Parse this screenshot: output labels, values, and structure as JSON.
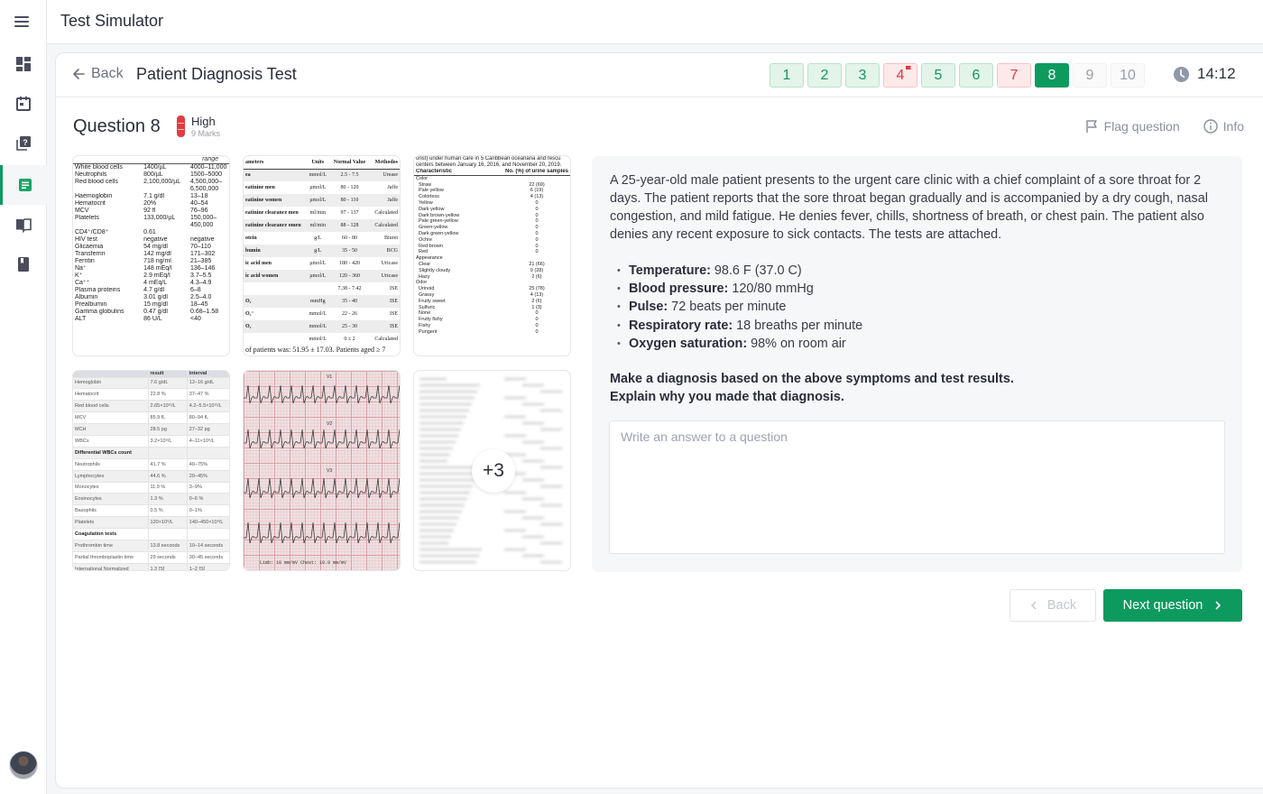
{
  "app": {
    "title": "Test Simulator"
  },
  "sidebar": {
    "items": [
      {
        "name": "dashboard",
        "icon": "dashboard-icon",
        "active": false
      },
      {
        "name": "calendar",
        "icon": "calendar-icon",
        "active": false
      },
      {
        "name": "question-bank",
        "icon": "question-bank-icon",
        "active": false
      },
      {
        "name": "tests",
        "icon": "document-icon",
        "active": true
      },
      {
        "name": "library",
        "icon": "open-book-icon",
        "active": false
      },
      {
        "name": "bookmarks",
        "icon": "book-icon",
        "active": false
      }
    ],
    "accent_color": "#0d9a5f"
  },
  "header": {
    "back_label": "Back",
    "test_title": "Patient Diagnosis Test",
    "timer": "14:12",
    "questions": [
      {
        "label": "1",
        "status": "done"
      },
      {
        "label": "2",
        "status": "done"
      },
      {
        "label": "3",
        "status": "done"
      },
      {
        "label": "4",
        "status": "wrong",
        "flagged": true
      },
      {
        "label": "5",
        "status": "done"
      },
      {
        "label": "6",
        "status": "done"
      },
      {
        "label": "7",
        "status": "wrong"
      },
      {
        "label": "8",
        "status": "current"
      },
      {
        "label": "9",
        "status": "todo"
      },
      {
        "label": "10",
        "status": "todo"
      }
    ]
  },
  "question": {
    "title": "Question 8",
    "difficulty": "High",
    "marks": "9 Marks",
    "flag_label": "Flag question",
    "info_label": "Info",
    "case_text": "A 25-year-old male patient presents to the urgent care clinic with a chief complaint of a sore throat for 2 days. The patient reports that the sore throat began gradually and is accompanied by a dry cough, nasal congestion, and mild fatigue. He denies fever, chills, shortness of breath, or chest pain. The patient also denies any recent exposure to sick contacts. The tests are attached.",
    "vitals": [
      {
        "label": "Temperature:",
        "value": " 98.6 F (37.0 C)"
      },
      {
        "label": "Blood pressure:",
        "value": " 120/80 mmHg"
      },
      {
        "label": "Pulse:",
        "value": " 72 beats per minute"
      },
      {
        "label": "Respiratory rate:",
        "value": " 18 breaths per minute"
      },
      {
        "label": "Oxygen saturation:",
        "value": " 98% on room air"
      }
    ],
    "prompt_line1": "Make a diagnosis based on the above symptoms and test results.",
    "prompt_line2": "Explain why you made that diagnosis.",
    "answer_placeholder": "Write an answer to a question",
    "answer_value": ""
  },
  "attachments": {
    "more_count": "+3",
    "lab1": {
      "header": "range",
      "rows": [
        [
          "White blood cells",
          "1400/µL",
          "4000–11,000"
        ],
        [
          "Neutrophils",
          "800/µL",
          "1500–5000"
        ],
        [
          "Red blood cells",
          "2,100,000/µL",
          "4,500,000–"
        ],
        [
          "",
          "",
          "6,500,000"
        ],
        [
          "Haemoglobin",
          "7.1 g/dl",
          "13–18"
        ],
        [
          "Hematocrit",
          "20%",
          "40–54"
        ],
        [
          "MCV",
          "92 fl",
          "76–96"
        ],
        [
          "Platelets",
          "133,000/µL",
          "150,000–"
        ],
        [
          "",
          "",
          "450,000"
        ],
        [
          "CD4⁺/CD8⁺",
          "0.61",
          ""
        ],
        [
          "HIV test",
          "negative",
          "negative"
        ],
        [
          "Glicaemia",
          "54 mg/dl",
          "70–110"
        ],
        [
          "Transferrin",
          "142 mg/dl",
          "171–302"
        ],
        [
          "Ferritin",
          "718 ng/ml",
          "21–385"
        ],
        [
          "Na⁺",
          "148 mEq/l",
          "136–146"
        ],
        [
          "K⁺",
          "2.9 mEq/l",
          "3.7–5.5"
        ],
        [
          "Ca⁺⁺",
          "4 mEq/L",
          "4.3–4.9"
        ],
        [
          "Plasma proteins",
          "4.7 g/dl",
          "6–8"
        ],
        [
          "Albumin",
          "3.01 g/dl",
          "2.5–4.0"
        ],
        [
          "Prealbumin",
          "15 mg/dl",
          "18–45"
        ],
        [
          "Gamma globulins",
          "0.47 g/dl",
          "0.68–1.58"
        ],
        [
          "ALT",
          "86 U/L",
          "<40"
        ]
      ]
    },
    "lab2": {
      "header": [
        "ameters",
        "Units",
        "Normal Value",
        "Methodos"
      ],
      "rows": [
        [
          "ea",
          "mmol/L",
          "2.5 - 7.5",
          "Urease"
        ],
        [
          "eatinine men",
          "µmol/L",
          "80 - 120",
          "Jaffe"
        ],
        [
          "eatinine women",
          "µmol/L",
          "80 - 110",
          "Jaffe"
        ],
        [
          "eatinine clearance men",
          "ml/min",
          "97 - 137",
          "Calculated"
        ],
        [
          "eatinine clearance omen",
          "ml/min",
          "88 - 128",
          "Calculated"
        ],
        [
          "otein",
          "g/L",
          "60 - 80",
          "Biuret"
        ],
        [
          "bumin",
          "g/L",
          "35 - 50",
          "BCG"
        ],
        [
          "ic acid men",
          "µmol/L",
          "180 - 420",
          "Uricase"
        ],
        [
          "ic acid women",
          "µmol/L",
          "120 - 360",
          "Uricase"
        ],
        [
          "",
          "",
          "7.38 - 7.42",
          "ISE"
        ],
        [
          "O₂",
          "mmHg",
          "35 - 40",
          "ISE"
        ],
        [
          "O₃⁻",
          "mmol/L",
          "22 - 26",
          "ISE"
        ],
        [
          "O₂",
          "mmol/L",
          "25 - 30",
          "ISE"
        ],
        [
          "",
          "mmol/L",
          "0 ± 2",
          "Calculated"
        ]
      ],
      "footer": "of patients was: 51.95 ± 17.03. Patients aged ≥ 7"
    },
    "lab3": {
      "caption": [
        "urist) under human care in 5 Caribbean oceanaria and rescu",
        "centers between January 16, 2016, and November 20, 2019."
      ],
      "header": [
        "Characteristic",
        "No. (%) of urine samples"
      ],
      "rows": [
        [
          "Color",
          "",
          "group"
        ],
        [
          "Straw",
          "22 (69)",
          ""
        ],
        [
          "Pale yellow",
          "6 (19)",
          ""
        ],
        [
          "Colorless",
          "4 (13)",
          ""
        ],
        [
          "Yellow",
          "0",
          ""
        ],
        [
          "Dark yellow",
          "0",
          ""
        ],
        [
          "Dark brown-yellow",
          "0",
          ""
        ],
        [
          "Pale green-yellow",
          "0",
          ""
        ],
        [
          "Green-yellow",
          "0",
          ""
        ],
        [
          "Dark green-yellow",
          "0",
          ""
        ],
        [
          "Ochre",
          "0",
          ""
        ],
        [
          "Red-brown",
          "0",
          ""
        ],
        [
          "Red",
          "0",
          ""
        ],
        [
          "",
          "",
          "gap"
        ],
        [
          "Appearance",
          "",
          "group"
        ],
        [
          "Clear",
          "21 (66)",
          ""
        ],
        [
          "Slightly cloudy",
          "9 (28)",
          ""
        ],
        [
          "Hazy",
          "2 (6)",
          ""
        ],
        [
          "",
          "",
          "gap"
        ],
        [
          "Odor",
          "",
          "group"
        ],
        [
          "Urinoid",
          "25 (78)",
          ""
        ],
        [
          "Grassy",
          "4 (13)",
          ""
        ],
        [
          "Fruity sweet",
          "2 (6)",
          ""
        ],
        [
          "Sulfuric",
          "1 (3)",
          ""
        ],
        [
          "None",
          "0",
          ""
        ],
        [
          "Fruity fishy",
          "0",
          ""
        ],
        [
          "Fishy",
          "0",
          ""
        ],
        [
          "Pungent",
          "0",
          ""
        ]
      ]
    },
    "lab4": {
      "header": [
        "",
        "result",
        "interval"
      ],
      "rows": [
        [
          "Hemoglobin",
          "7.6 g/dL",
          "12–16 g/dL",
          ""
        ],
        [
          "Hematocrit",
          "22.8 %",
          "37–47 %",
          ""
        ],
        [
          "Red blood cells",
          "2.65×10¹²/L",
          "4.2–5.5×10¹²/L",
          ""
        ],
        [
          "MCV",
          "85.9 fL",
          "80–94 fL",
          ""
        ],
        [
          "MCH",
          "28.5 pg",
          "27–32 pg",
          ""
        ],
        [
          "WBCs",
          "3.2×10⁹/L",
          "4–11×10⁹/L",
          ""
        ],
        [
          "Differential WBCs count",
          "",
          "",
          "sec"
        ],
        [
          "Neutrophils",
          "41.7 %",
          "40–75%",
          ""
        ],
        [
          "Lymphocytes",
          "44.6 %",
          "20–45%",
          ""
        ],
        [
          "Monocytes",
          "11.9 %",
          "3–9%",
          ""
        ],
        [
          "Eosinocytes",
          "1.3 %",
          "0–6 %",
          ""
        ],
        [
          "Basophils",
          "0.5 %",
          "0–1%",
          ""
        ],
        [
          "Platelets",
          "120×10⁹/L",
          "140–450×10⁹/L",
          ""
        ],
        [
          "Coagulation tests",
          "",
          "",
          "sec"
        ],
        [
          "Prothrombin time",
          "13.8 seconds",
          "10–14 seconds",
          ""
        ],
        [
          "Partial thromboplastin time",
          "29 seconds",
          "30–45 seconds",
          ""
        ],
        [
          "International Normalized",
          "1.3 [S]",
          "1–2 [S]",
          ""
        ]
      ]
    },
    "ecg": {
      "leads": [
        "V1",
        "V2",
        "V3"
      ],
      "footer": "Limb: 10 mm/mV   Chest: 10.0 mm/mV"
    }
  },
  "footer": {
    "back_label": "Back",
    "next_label": "Next question"
  }
}
